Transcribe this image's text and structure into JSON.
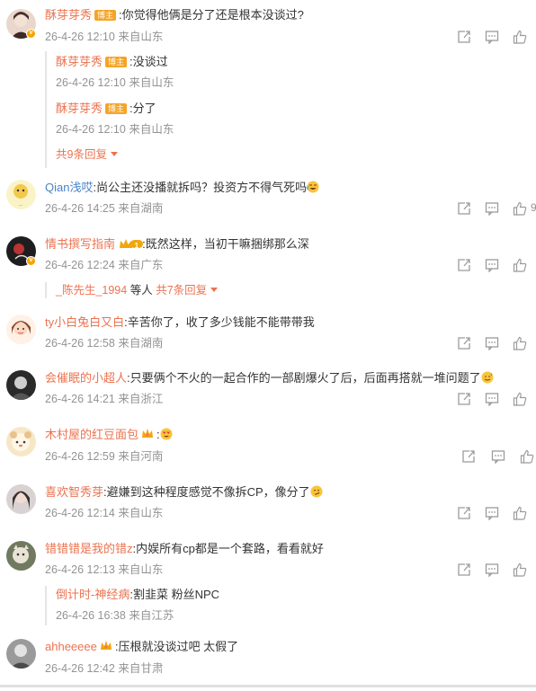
{
  "comments": [
    {
      "username": "酥芽芽秀",
      "badge": "博主",
      "text": ":你觉得他俩是分了还是根本没谈过?",
      "time": "26-4-26 12:10",
      "location": "来自山东",
      "replies": [
        {
          "username": "酥芽芽秀",
          "badge": "博主",
          "text": ":没谈过",
          "time": "26-4-26 12:10",
          "location": "来自山东"
        },
        {
          "username": "酥芽芽秀",
          "badge": "博主",
          "text": ":分了",
          "time": "26-4-26 12:10",
          "location": "来自山东"
        }
      ],
      "more_replies": "共9条回复"
    },
    {
      "username": "Qian浅哎",
      "text": ":尚公主还没播就拆吗？投资方不得气死吗",
      "time": "26-4-26 14:25",
      "location": "来自湖南",
      "like_partial": "9"
    },
    {
      "username": "情书撰写指南",
      "badge_level": "1",
      "text": ":既然这样，当初干嘛捆绑那么深",
      "time": "26-4-26 12:24",
      "location": "来自广东",
      "reply_summary": {
        "user": "_陈先生_1994",
        "suffix": "等人",
        "count": "共7条回复"
      }
    },
    {
      "username": "ty小白兔白又白",
      "text": ":辛苦你了，收了多少钱能不能带带我",
      "time": "26-4-26 12:58",
      "location": "来自湖南"
    },
    {
      "username": "会催眠的小超人",
      "text": ":只要俩个不火的一起合作的一部剧爆火了后，后面再搭就一堆问题了",
      "time": "26-4-26 14:21",
      "location": "来自浙江"
    },
    {
      "username": "木村屋的红豆面包",
      "text": ":",
      "time": "26-4-26 12:59",
      "location": "来自河南"
    },
    {
      "username": "喜欢智秀芽",
      "text": ":避嫌到这种程度感觉不像拆CP，像分了",
      "time": "26-4-26 12:14",
      "location": "来自山东"
    },
    {
      "username": "错错错是我的错z",
      "text": ":内娱所有cp都是一个套路，看看就好",
      "time": "26-4-26 12:13",
      "location": "来自山东",
      "replies": [
        {
          "username": "倒计时-神经病",
          "text": ":割韭菜 粉丝NPC",
          "time": "26-4-26 16:38",
          "location": "来自江苏"
        }
      ]
    },
    {
      "username": "ahheeeee",
      "text": ":压根就没谈过吧 太假了",
      "time": "26-4-26 12:42",
      "location": "来自甘肃"
    }
  ],
  "icons": {
    "share": "share-icon",
    "comment": "comment-icon",
    "like": "like-icon"
  },
  "colors": {
    "username": "#eb7350",
    "meta": "#939393",
    "badge": "#f7a326",
    "icon": "#9b9b9b"
  }
}
